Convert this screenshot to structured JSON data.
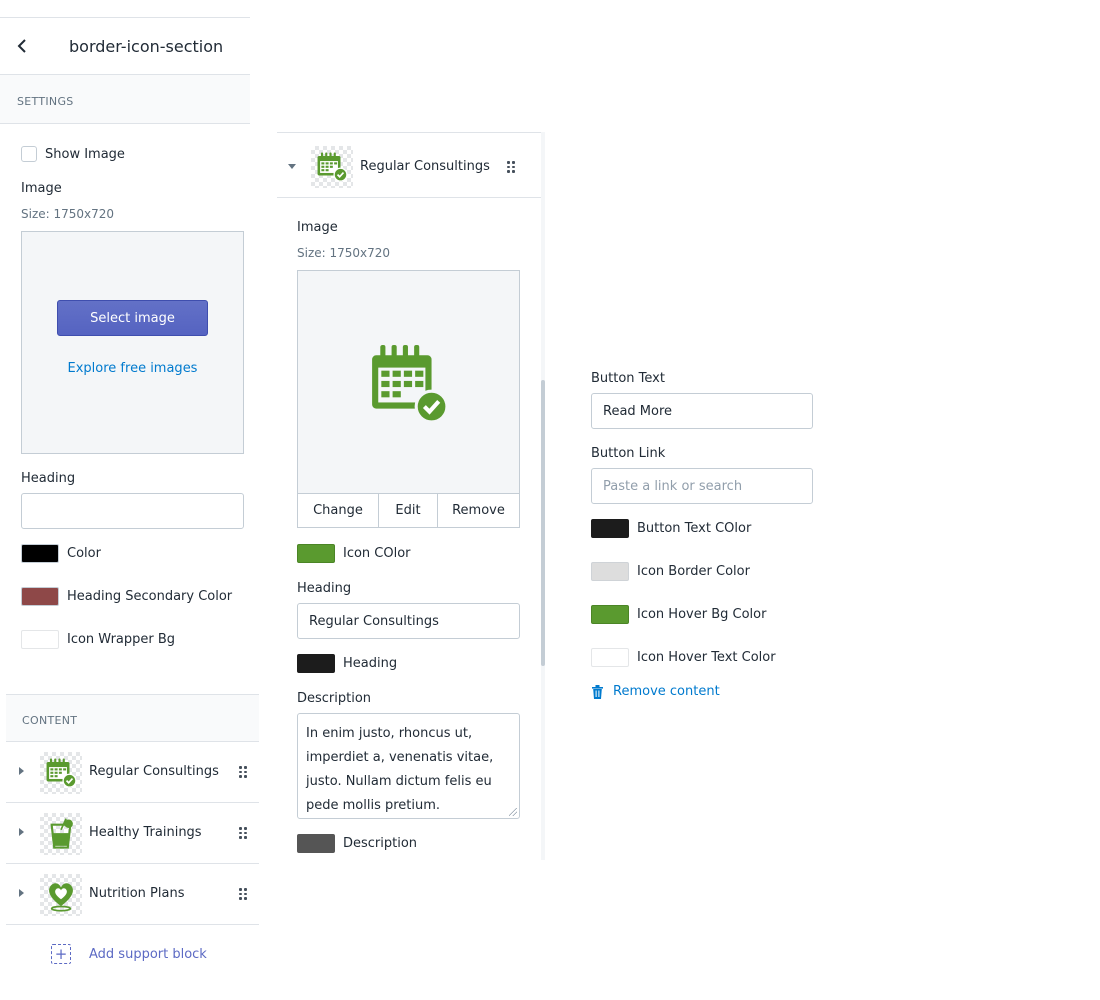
{
  "header": {
    "title": "border-icon-section"
  },
  "settings": {
    "caption": "SETTINGS",
    "show_image_label": "Show Image",
    "image_label": "Image",
    "image_size": "Size: 1750x720",
    "select_image": "Select image",
    "explore_free_images": "Explore free images",
    "heading_label": "Heading",
    "heading_value": "",
    "colors": [
      {
        "label": "Color",
        "value": "#000000"
      },
      {
        "label": "Heading Secondary Color",
        "value": "#8e4848"
      },
      {
        "label": "Icon Wrapper Bg",
        "value": "#ffffff"
      }
    ]
  },
  "content": {
    "caption": "CONTENT",
    "blocks": [
      {
        "label": "Regular Consultings",
        "icon": "calendar-check-icon"
      },
      {
        "label": "Healthy Trainings",
        "icon": "drink-glass-icon"
      },
      {
        "label": "Nutrition Plans",
        "icon": "heart-location-icon"
      }
    ],
    "add_block": "Add support block"
  },
  "block_editor": {
    "title": "Regular Consultings",
    "image_label": "Image",
    "image_size": "Size: 1750x720",
    "actions": {
      "change": "Change",
      "edit": "Edit",
      "remove": "Remove"
    },
    "icon_color_label": "Icon COlor",
    "icon_color": "#5a9a2f",
    "heading_label": "Heading",
    "heading_value": "Regular Consultings",
    "heading_color_label": "Heading",
    "heading_color": "#1c1c1c",
    "description_label": "Description",
    "description_value": "In enim justo, rhoncus ut, imperdiet a, venenatis vitae, justo. Nullam dictum felis eu pede mollis pretium.",
    "description_color_label": "Description",
    "description_color": "#555555"
  },
  "block_editor_more": {
    "button_text_label": "Button Text",
    "button_text_value": "Read More",
    "button_link_label": "Button Link",
    "button_link_placeholder": "Paste a link or search",
    "colors": [
      {
        "label": "Button Text COlor",
        "value": "#1c1c1c"
      },
      {
        "label": "Icon Border Color",
        "value": "#dddddd"
      },
      {
        "label": "Icon Hover Bg Color",
        "value": "#5a9a2f"
      },
      {
        "label": "Icon Hover Text Color",
        "value": "#ffffff"
      }
    ],
    "remove_content": "Remove content"
  }
}
